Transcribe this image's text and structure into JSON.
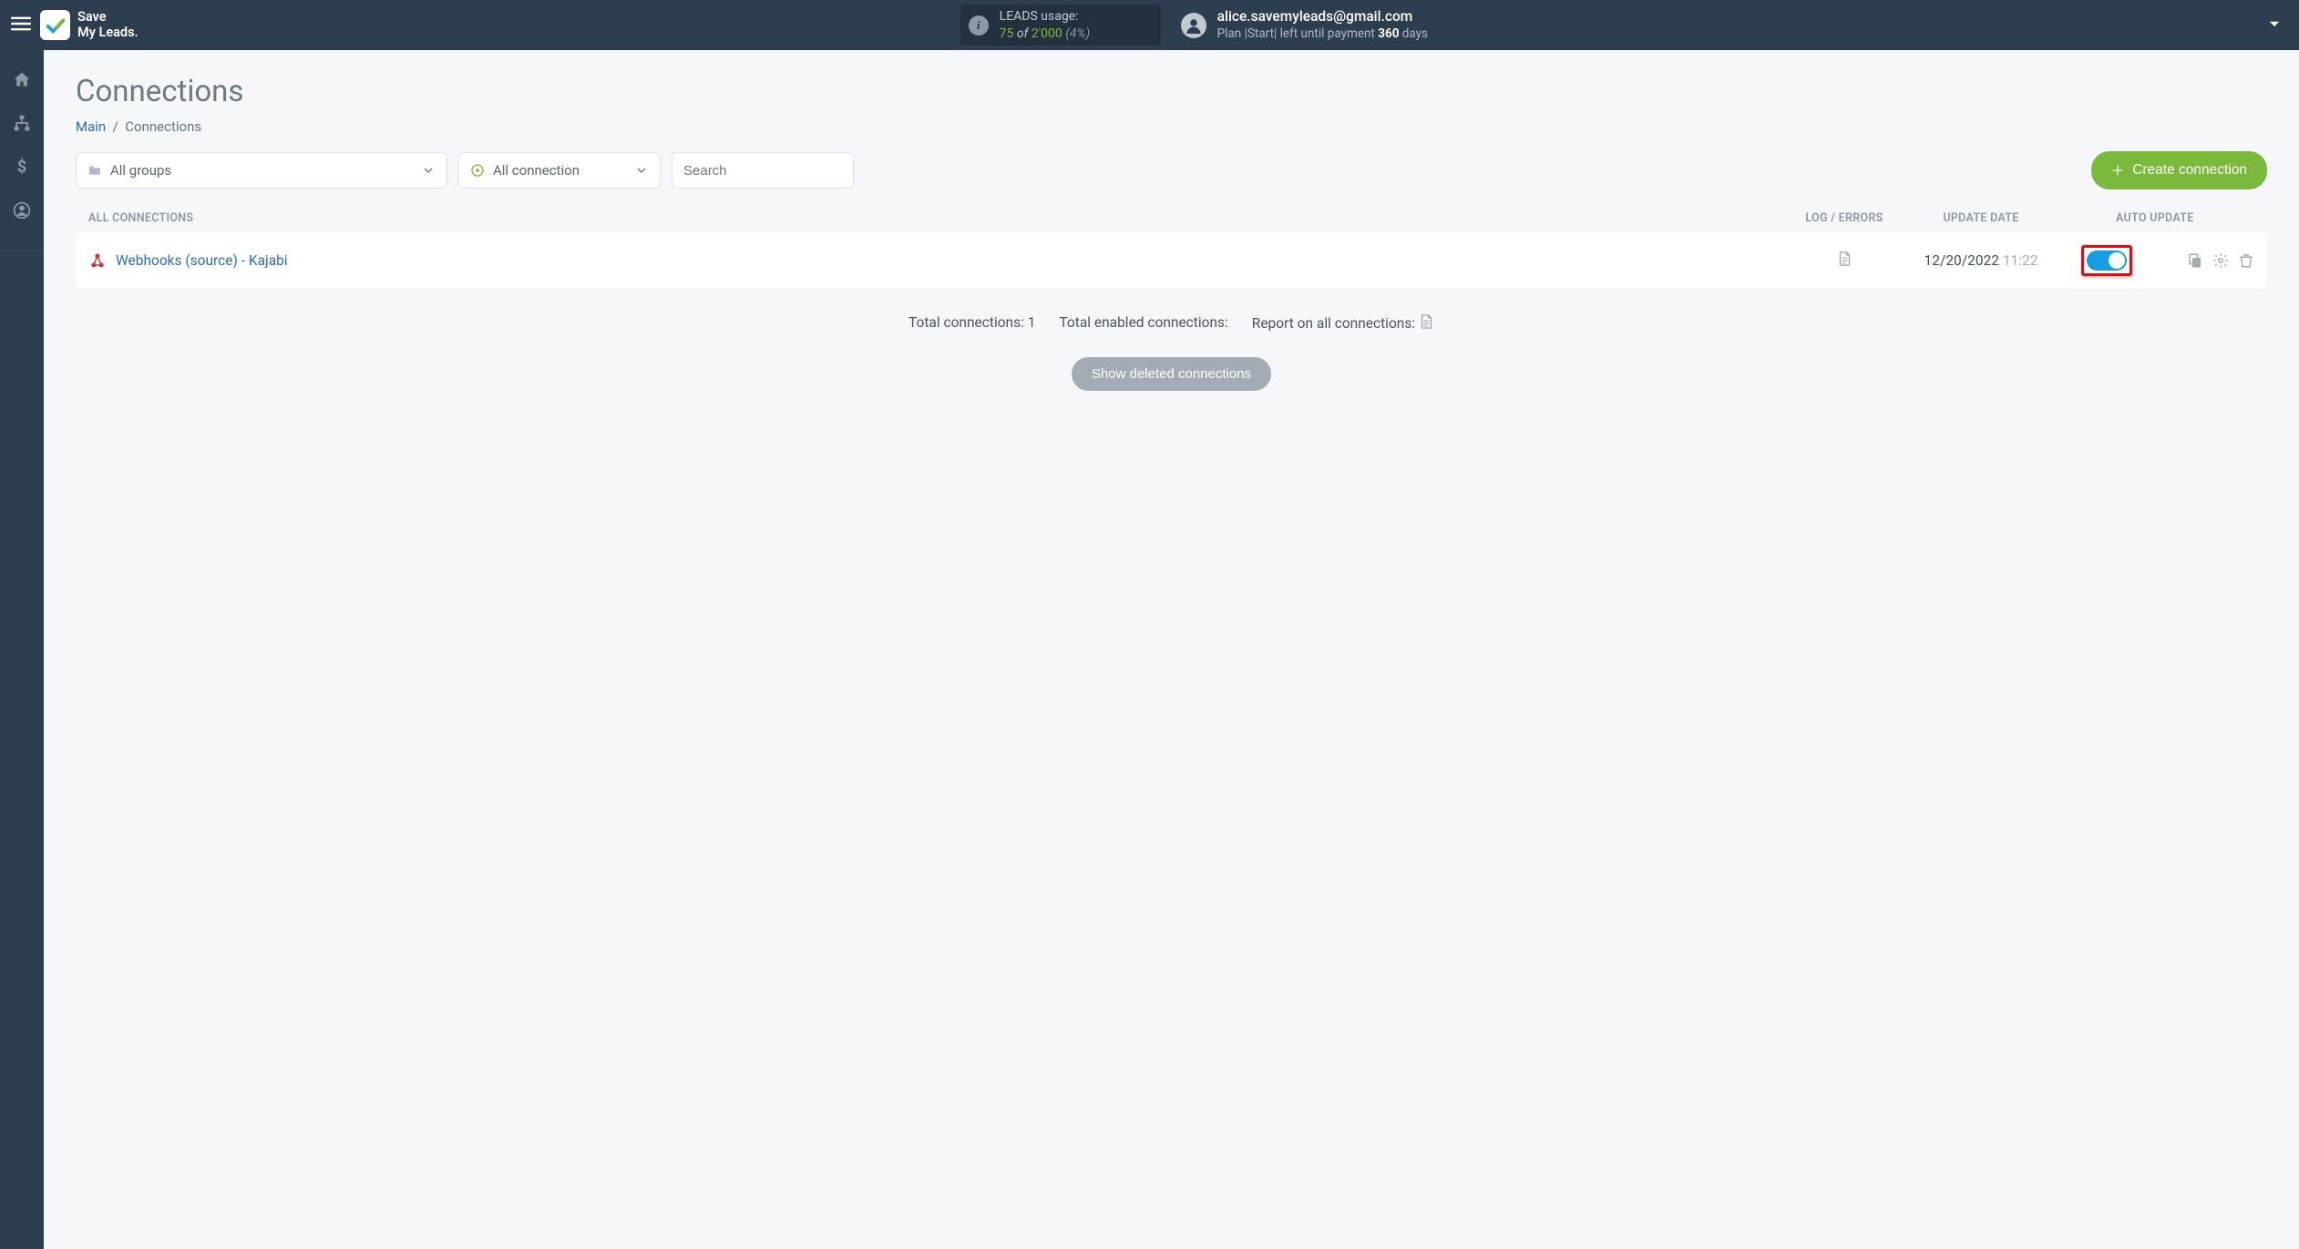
{
  "header": {
    "brand_line1": "Save",
    "brand_line2": "My Leads.",
    "usage": {
      "title": "LEADS usage:",
      "used": "75",
      "of": "of",
      "total": "2'000",
      "pct": "(4%)"
    },
    "account": {
      "email": "alice.savemyleads@gmail.com",
      "plan_prefix": "Plan |Start| left until payment ",
      "plan_days_num": "360",
      "plan_days_suffix": " days"
    }
  },
  "page": {
    "title": "Connections",
    "breadcrumb_main": "Main",
    "breadcrumb_sep": "/",
    "breadcrumb_current": "Connections"
  },
  "filters": {
    "groups_label": "All groups",
    "conn_label": "All connection",
    "search_placeholder": "Search",
    "create_btn": "Create connection"
  },
  "columns": {
    "name": "ALL CONNECTIONS",
    "log": "LOG / ERRORS",
    "date": "UPDATE DATE",
    "auto": "AUTO UPDATE"
  },
  "rows": [
    {
      "name": "Webhooks (source) - Kajabi",
      "date": "12/20/2022",
      "time": "11:22",
      "auto_on": true
    }
  ],
  "summary": {
    "total_connections_label": "Total connections: ",
    "total_connections_value": "1",
    "total_enabled_label": "Total enabled connections:",
    "report_label": "Report on all connections:"
  },
  "show_deleted": "Show deleted connections"
}
